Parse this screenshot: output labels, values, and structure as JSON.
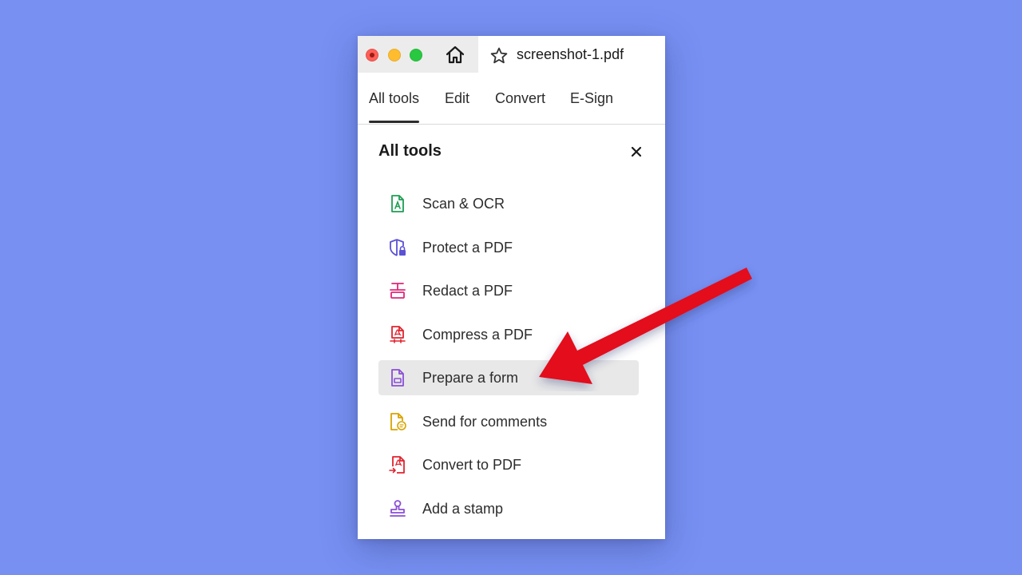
{
  "window": {
    "tab_title": "screenshot-1.pdf"
  },
  "nav": {
    "tabs": [
      {
        "label": "All tools",
        "active": true
      },
      {
        "label": "Edit",
        "active": false
      },
      {
        "label": "Convert",
        "active": false
      },
      {
        "label": "E-Sign",
        "active": false
      }
    ]
  },
  "panel": {
    "title": "All tools",
    "close_icon": "close-icon",
    "tools": [
      {
        "label": "Scan & OCR",
        "icon": "scan-ocr-icon",
        "color": "#1f9d55"
      },
      {
        "label": "Protect a PDF",
        "icon": "protect-shield-icon",
        "color": "#5b52d6"
      },
      {
        "label": "Redact a PDF",
        "icon": "redact-icon",
        "color": "#e0267a"
      },
      {
        "label": "Compress a PDF",
        "icon": "compress-pdf-icon",
        "color": "#e0242f"
      },
      {
        "label": "Prepare a form",
        "icon": "prepare-form-icon",
        "color": "#8b4fd6",
        "selected": true
      },
      {
        "label": "Send for comments",
        "icon": "send-comments-icon",
        "color": "#d9a300"
      },
      {
        "label": "Convert to PDF",
        "icon": "convert-pdf-icon",
        "color": "#e0242f"
      },
      {
        "label": "Add a stamp",
        "icon": "stamp-icon",
        "color": "#8b4fd6"
      }
    ]
  },
  "colors": {
    "background": "#7790f2",
    "annotation_arrow": "#e3101c",
    "selected_row": "#e8e8e8"
  }
}
